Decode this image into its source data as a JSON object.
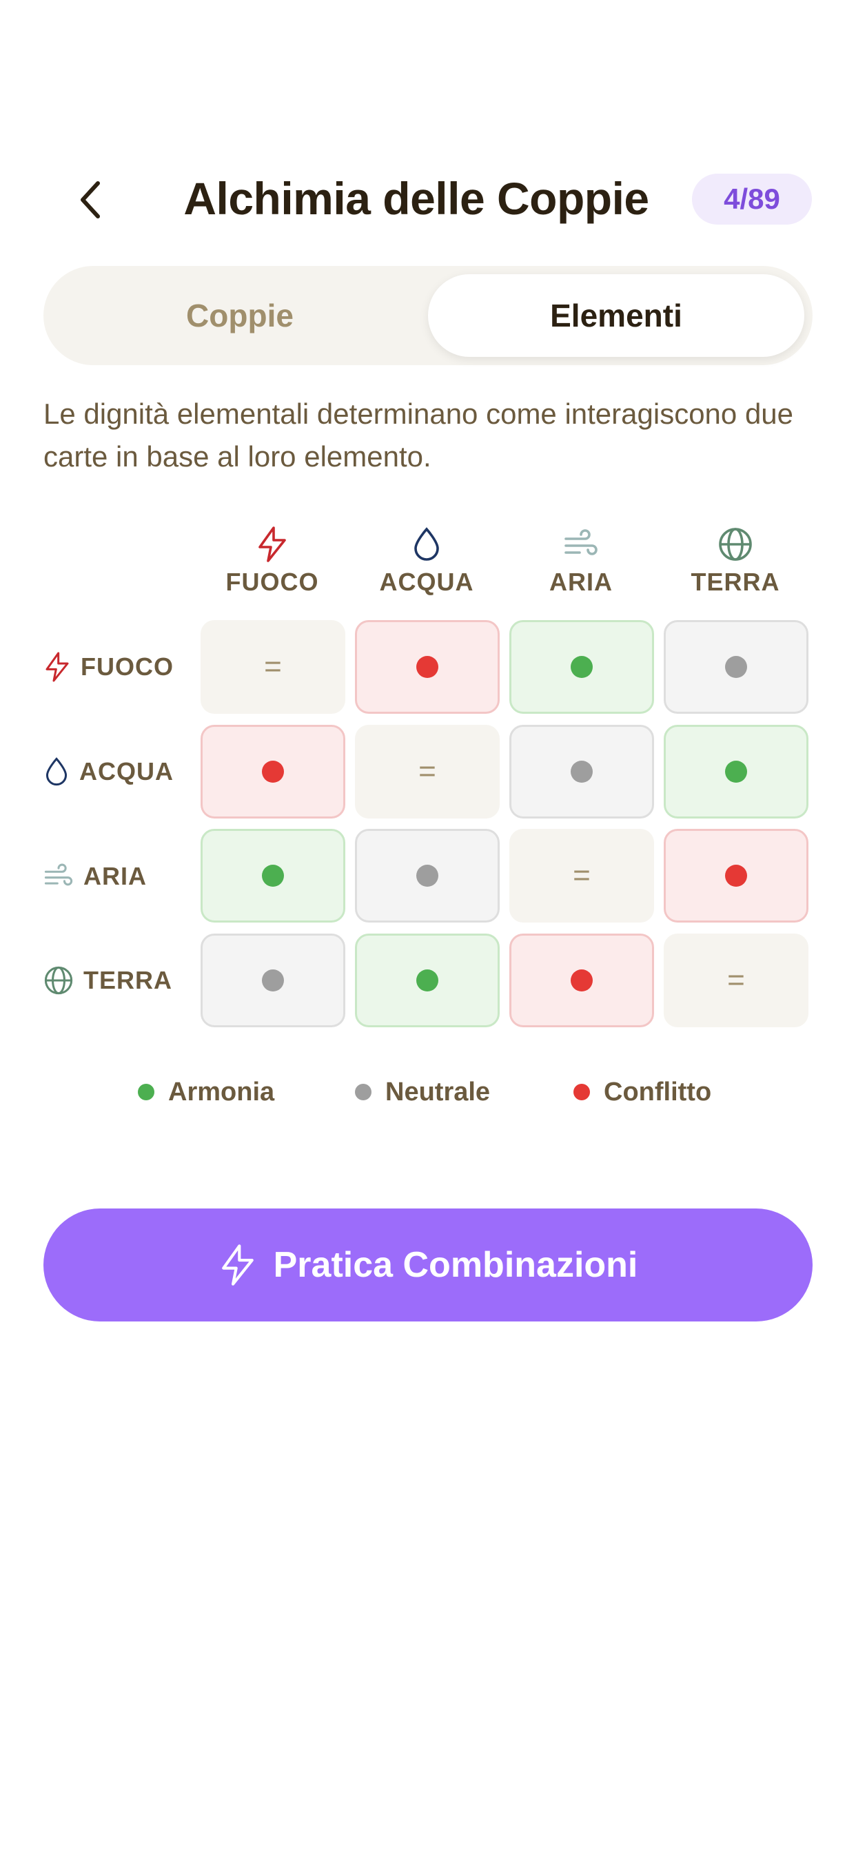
{
  "header": {
    "title": "Alchimia delle Coppie",
    "count": "4/89",
    "back_icon": "chevron-left-icon"
  },
  "tabs": [
    {
      "label": "Coppie",
      "active": false
    },
    {
      "label": "Elementi",
      "active": true
    }
  ],
  "description": "Le dignità elementali determinano come interagiscono due carte in base al loro elemento.",
  "elements": [
    {
      "label": "FUOCO",
      "icon": "lightning-icon",
      "color": "#c8282d"
    },
    {
      "label": "ACQUA",
      "icon": "water-drop-icon",
      "color": "#1e3664"
    },
    {
      "label": "ARIA",
      "icon": "wind-icon",
      "color": "#9bb6b5"
    },
    {
      "label": "TERRA",
      "icon": "globe-icon",
      "color": "#5f8a70"
    }
  ],
  "matrix": [
    [
      "same",
      "conflict",
      "harmony",
      "neutral"
    ],
    [
      "conflict",
      "same",
      "neutral",
      "harmony"
    ],
    [
      "harmony",
      "neutral",
      "same",
      "conflict"
    ],
    [
      "neutral",
      "harmony",
      "conflict",
      "same"
    ]
  ],
  "same_symbol": "=",
  "legend": [
    {
      "label": "Armonia",
      "color": "#4caf50"
    },
    {
      "label": "Neutrale",
      "color": "#9e9e9e"
    },
    {
      "label": "Conflitto",
      "color": "#e53935"
    }
  ],
  "cta": {
    "label": "Pratica Combinazioni",
    "icon": "lightning-icon"
  }
}
